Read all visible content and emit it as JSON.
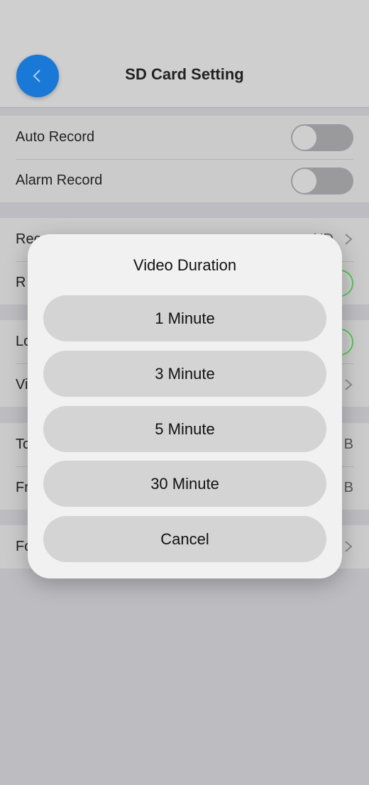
{
  "header": {
    "title": "SD Card Setting"
  },
  "group1": {
    "items": [
      {
        "label": "Auto Record",
        "toggle": "off"
      },
      {
        "label": "Alarm Record",
        "toggle": "off"
      }
    ]
  },
  "group2": {
    "items": [
      {
        "label": "Rec",
        "right_text": "ND",
        "control": "chevron"
      },
      {
        "label": "R",
        "control": "toggle-on"
      }
    ]
  },
  "group3": {
    "items": [
      {
        "label": "Lo",
        "control": "toggle-on"
      },
      {
        "label": "Vi",
        "control": "chevron"
      }
    ]
  },
  "group4": {
    "items": [
      {
        "label": "To",
        "right_text": "B"
      },
      {
        "label": "Fr",
        "right_text": "B"
      }
    ]
  },
  "group5": {
    "items": [
      {
        "label": "Fo",
        "control": "chevron"
      }
    ]
  },
  "dialog": {
    "title": "Video Duration",
    "options": [
      "1 Minute",
      "3 Minute",
      "5 Minute",
      "30 Minute"
    ],
    "cancel": "Cancel"
  },
  "colors": {
    "accent": "#1a78d6",
    "toggle_on": "#58c458"
  }
}
